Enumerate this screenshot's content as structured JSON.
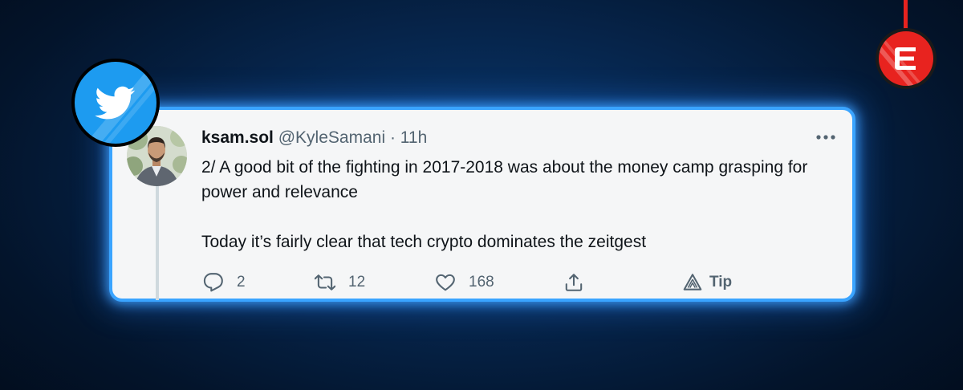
{
  "tweet": {
    "display_name": "ksam.sol",
    "handle": "@KyleSamani",
    "separator": "·",
    "time": "11h",
    "lines": [
      "2/ A good bit of the fighting in 2017-2018 was about the money camp grasping for power and relevance",
      "Today it’s fairly clear that tech crypto dominates the zeitgest"
    ]
  },
  "actions": {
    "reply_count": "2",
    "retweet_count": "12",
    "like_count": "168",
    "tip_label": "Tip"
  },
  "icons": {
    "source_badge": "twitter-bird-icon",
    "brand_badge": "e-logo-icon",
    "more": "more-horizontal-icon",
    "reply": "reply-icon",
    "retweet": "retweet-icon",
    "like": "heart-icon",
    "share": "share-icon",
    "tip": "tip-icon"
  },
  "colors": {
    "accent_blue": "#1d9bf0",
    "card_border": "#3aa4ff",
    "brand_red": "#e8231f",
    "text_primary": "#0f1419",
    "text_secondary": "#536471"
  }
}
